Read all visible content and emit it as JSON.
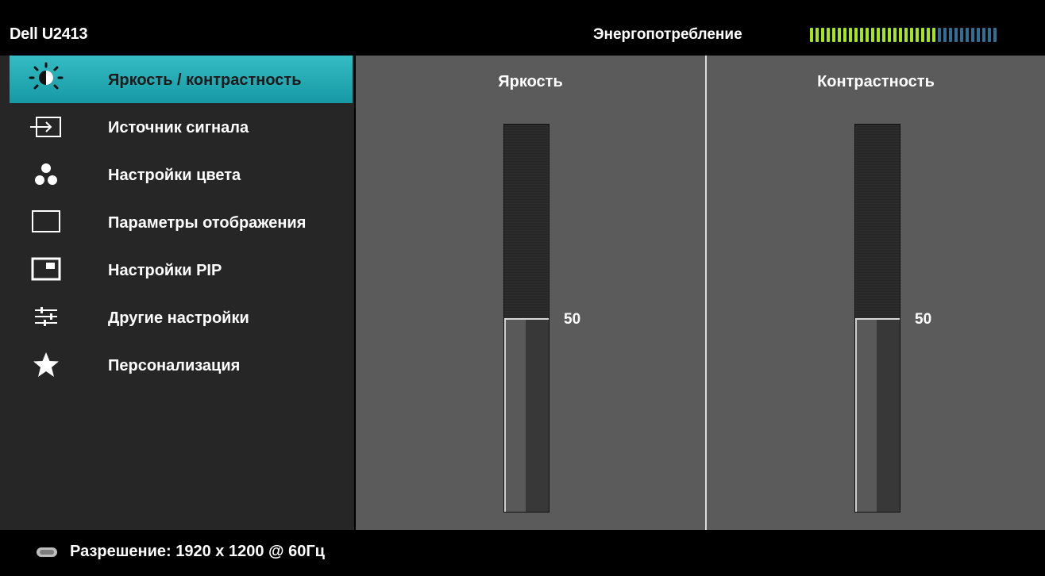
{
  "header": {
    "model": "Dell U2413",
    "energy_label": "Энергопотребление",
    "energy_level_fraction": 0.68
  },
  "sidebar": {
    "items": [
      {
        "label": "Яркость / контрастность",
        "icon": "brightness-contrast-icon",
        "active": true
      },
      {
        "label": "Источник сигнала",
        "icon": "input-source-icon"
      },
      {
        "label": "Настройки цвета",
        "icon": "color-settings-icon"
      },
      {
        "label": "Параметры отображения",
        "icon": "display-icon"
      },
      {
        "label": "Настройки PIP",
        "icon": "pip-icon"
      },
      {
        "label": "Другие настройки",
        "icon": "sliders-icon"
      },
      {
        "label": "Персонализация",
        "icon": "star-icon"
      }
    ]
  },
  "panels": {
    "brightness": {
      "title": "Яркость",
      "value": "50",
      "level": 0.5
    },
    "contrast": {
      "title": "Контрастность",
      "value": "50",
      "level": 0.5
    }
  },
  "footer": {
    "resolution": "Разрешение: 1920 x 1200 @ 60Гц",
    "icon": "display-connector-icon"
  },
  "colors": {
    "accent": "#1ea7b1",
    "energy_on": "#a5e617",
    "energy_off": "#2f6f95"
  }
}
